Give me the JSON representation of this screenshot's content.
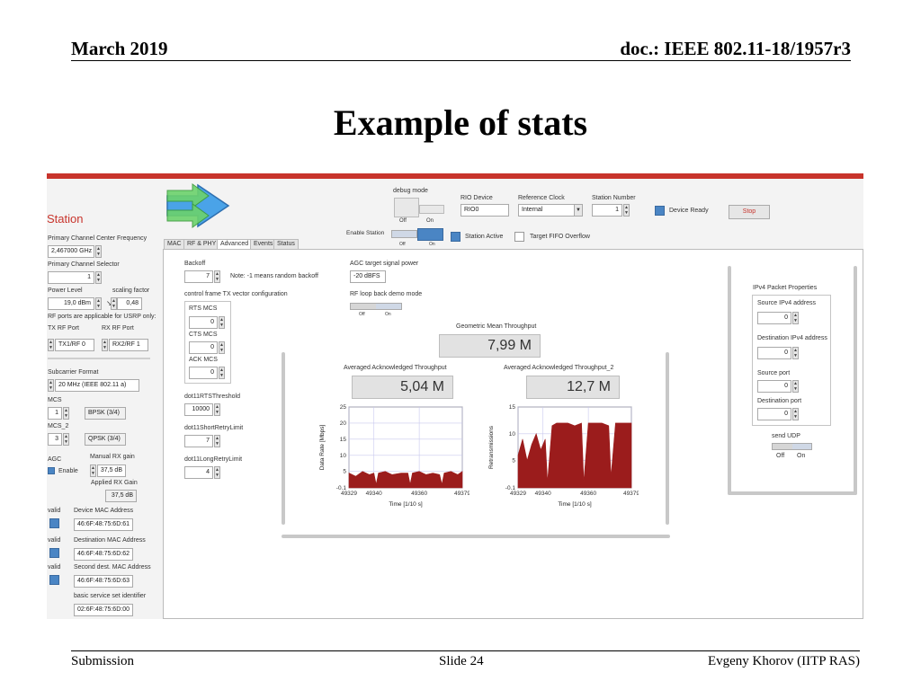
{
  "header": {
    "date": "March 2019",
    "doc": "doc.: IEEE 802.11-18/1957r3"
  },
  "title": "Example of stats",
  "footer": {
    "left": "Submission",
    "center": "Slide 24",
    "right": "Evgeny Khorov (IITP RAS)"
  },
  "app": {
    "station_label": "Station",
    "accent_color": "#c8342c",
    "top": {
      "debug_mode": "debug mode",
      "off": "Off",
      "on": "On",
      "rio_device_label": "RIO Device",
      "rio_device_value": "RIO0",
      "ref_clock_label": "Reference Clock",
      "ref_clock_value": "Internal",
      "station_number_label": "Station Number",
      "station_number_value": "1",
      "device_ready": "Device Ready",
      "stop": "Stop",
      "enable_station": "Enable Station",
      "station_active": "Station Active",
      "target_fifo": "Target FIFO Overflow"
    },
    "left": {
      "primary_freq_label": "Primary Channel Center Frequency",
      "primary_freq_value": "2,467000 GHz",
      "primary_sel_label": "Primary Channel Selector",
      "primary_sel_value": "1",
      "power_level_label": "Power Level",
      "power_level_value": "19,0 dBm",
      "scaling_factor_label": "scaling factor",
      "scaling_factor_value": "0,48",
      "rf_note": "RF ports are applicable for USRP only:",
      "tx_rf_label": "TX RF Port",
      "tx_rf_value": "TX1/RF 0",
      "rx_rf_label": "RX RF Port",
      "rx_rf_value": "RX2/RF 1",
      "subcarrier_label": "Subcarrier Format",
      "subcarrier_value": "20 MHz (IEEE 802.11 a)",
      "mcs_label": "MCS",
      "mcs_value": "1",
      "mcs_mod": "BPSK (3/4)",
      "mcs2_label": "MCS_2",
      "mcs2_value": "3",
      "mcs2_mod": "QPSK (3/4)",
      "agc_label": "AGC",
      "agc_enable": "Enable",
      "manual_rx_label": "Manual RX gain",
      "manual_rx_value": "37,5 dB",
      "applied_rx_label": "Applied RX Gain",
      "applied_rx_value": "37,5 dB",
      "valid": "valid",
      "device_mac_label": "Device MAC Address",
      "device_mac_value": "46:6F:48:75:6D:61",
      "dest_mac_label": "Destination MAC Address",
      "dest_mac_value": "46:6F:48:75:6D:62",
      "second_mac_label": "Second dest. MAC Address",
      "second_mac_value": "46:6F:48:75:6D:63",
      "bssid_label": "basic service set identifier",
      "bssid_value": "02:6F:48:75:6D:00"
    },
    "tabs": [
      "MAC",
      "RF & PHY",
      "Advanced",
      "Events",
      "Status"
    ],
    "advanced": {
      "backoff_label": "Backoff",
      "backoff_value": "7",
      "backoff_note": "Note: -1 means random backoff",
      "agc_target_label": "AGC target signal power",
      "agc_target_value": "-20 dBFS",
      "ctrl_frame_label": "control frame TX vector configuration",
      "rf_loop_label": "RF loop back demo mode",
      "rts_mcs_label": "RTS MCS",
      "rts_mcs_value": "0",
      "cts_mcs_label": "CTS MCS",
      "cts_mcs_value": "0",
      "ack_mcs_label": "ACK MCS",
      "ack_mcs_value": "0",
      "rts_thr_label": "dot11RTSThreshold",
      "rts_thr_value": "10000",
      "short_retry_label": "dot11ShortRetryLimit",
      "short_retry_value": "7",
      "long_retry_label": "dot11LongRetryLimit",
      "long_retry_value": "4"
    },
    "throughput": {
      "geo_label": "Geometric Mean Throughput",
      "geo_value": "7,99 M",
      "avg1_label": "Averaged Acknowledged Throughput",
      "avg1_value": "5,04 M",
      "avg2_label": "Averaged Acknowledged Throughput_2",
      "avg2_value": "12,7 M"
    },
    "ipv4": {
      "title": "IPv4 Packet Properties",
      "src_ip_label": "Source IPv4 address",
      "src_ip_value": "0",
      "dst_ip_label": "Destination IPv4 address",
      "dst_ip_value": "0",
      "src_port_label": "Source port",
      "src_port_value": "0",
      "dst_port_label": "Destination port",
      "dst_port_value": "0",
      "send_udp": "send UDP",
      "off": "Off",
      "on": "On"
    }
  },
  "chart_data": [
    {
      "type": "area",
      "xlabel": "Time [1/10 s]",
      "ylabel": "Data Rate [Mbps]",
      "xlim": [
        49329,
        49379
      ],
      "ylim": [
        -0.1,
        25
      ],
      "x_ticks": [
        49329,
        49340,
        49360,
        49379
      ],
      "y_ticks": [
        25,
        20,
        15,
        10,
        5,
        -0.1
      ],
      "color": "#9b1c1c",
      "x": [
        49329,
        49332,
        49335,
        49338,
        49340,
        49341,
        49342,
        49345,
        49348,
        49352,
        49355,
        49356,
        49357,
        49360,
        49363,
        49366,
        49369,
        49370,
        49371,
        49374,
        49377,
        49379
      ],
      "values": [
        4.5,
        3.5,
        5.0,
        4.0,
        4.5,
        1.0,
        4.5,
        5.0,
        4.0,
        4.5,
        4.5,
        1.0,
        4.5,
        5.0,
        4.0,
        4.5,
        4.0,
        1.0,
        4.5,
        5.0,
        4.0,
        5.0
      ]
    },
    {
      "type": "area",
      "xlabel": "Time [1/10 s]",
      "ylabel": "Retransmissions",
      "xlim": [
        49329,
        49379
      ],
      "ylim": [
        -0.1,
        15
      ],
      "x_ticks": [
        49329,
        49340,
        49360,
        49379
      ],
      "y_ticks": [
        15,
        10,
        5,
        -0.1
      ],
      "color": "#9b1c1c",
      "x": [
        49329,
        49331,
        49333,
        49335,
        49337,
        49339,
        49341,
        49342,
        49344,
        49346,
        49348,
        49351,
        49354,
        49357,
        49358,
        49360,
        49363,
        49366,
        49369,
        49370,
        49372,
        49375,
        49377,
        49379
      ],
      "values": [
        6,
        9,
        5,
        8,
        10,
        7,
        9,
        1,
        11.5,
        12,
        12,
        12,
        11.5,
        12,
        1,
        12,
        12,
        12,
        11.5,
        2,
        12,
        12,
        12,
        12
      ]
    }
  ]
}
